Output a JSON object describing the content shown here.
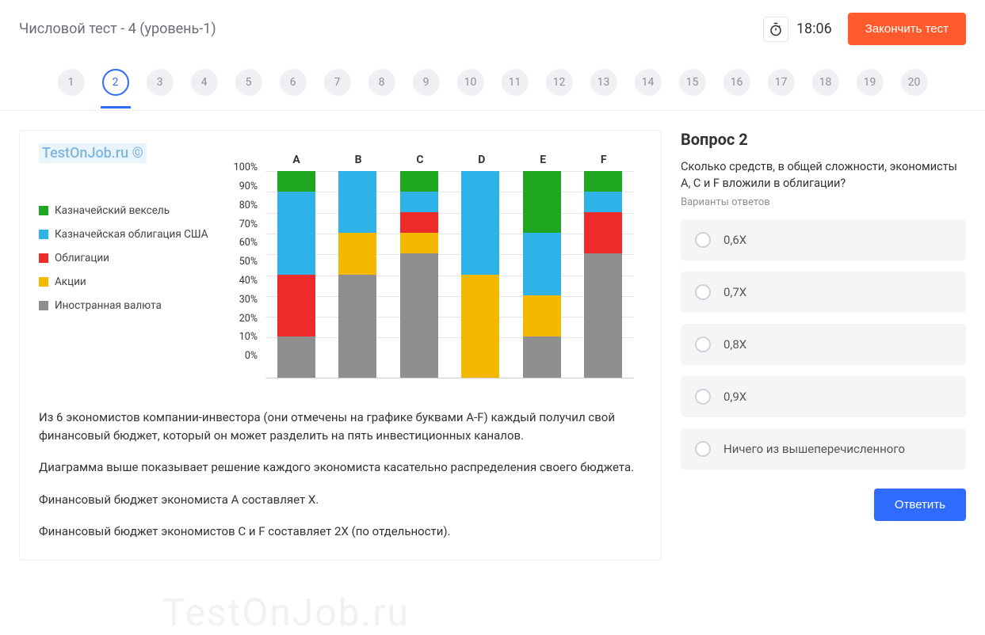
{
  "header": {
    "title": "Числовой тест - 4 (уровень-1)",
    "timer": "18:06",
    "finish_label": "Закончить тест"
  },
  "qnav": {
    "items": [
      "1",
      "2",
      "3",
      "4",
      "5",
      "6",
      "7",
      "8",
      "9",
      "10",
      "11",
      "12",
      "13",
      "14",
      "15",
      "16",
      "17",
      "18",
      "19",
      "20"
    ],
    "active_index": 1
  },
  "watermark": "TestOnJob.ru ©",
  "bg_watermark": "TestOnJob.ru",
  "legend": [
    {
      "label": "Казначейский вексель",
      "color": "#1fa81f"
    },
    {
      "label": "Казначейская облигация США",
      "color": "#2fb2e8"
    },
    {
      "label": "Облигации",
      "color": "#ef2a2a"
    },
    {
      "label": "Акции",
      "color": "#f5b800"
    },
    {
      "label": "Иностранная валюта",
      "color": "#8f8f8f"
    }
  ],
  "paragraphs": [
    "Из 6 экономистов компании-инвестора (они отмечены на графике буквами A-F) каждый получил свой финансовый бюджет, который он может разделить на пять инвестиционных каналов.",
    "Диаграмма выше показывает решение каждого экономиста касательно распределения своего бюджета.",
    "Финансовый бюджет экономиста A составляет X.",
    "Финансовый бюджет экономистов С и F составляет 2X  (по отдельности)."
  ],
  "question": {
    "heading": "Вопрос 2",
    "text": "Сколько средств, в общей сложности, экономисты A, C и F вложили в облигации?",
    "sub": "Варианты ответов",
    "options": [
      "0,6X",
      "0,7X",
      "0,8X",
      "0,9X",
      "Ничего из вышеперечисленного"
    ],
    "answer_btn": "Ответить"
  },
  "chart_data": {
    "type": "bar",
    "stacked": true,
    "categories": [
      "A",
      "B",
      "C",
      "D",
      "E",
      "F"
    ],
    "ylabel": "%",
    "ylim": [
      0,
      100
    ],
    "ticks": [
      "0%",
      "10%",
      "20%",
      "30%",
      "40%",
      "50%",
      "60%",
      "70%",
      "80%",
      "90%",
      "100%"
    ],
    "series": [
      {
        "name": "Иностранная валюта",
        "color": "#8f8f8f",
        "values": [
          20,
          50,
          60,
          0,
          20,
          60
        ]
      },
      {
        "name": "Акции",
        "color": "#f5b800",
        "values": [
          0,
          20,
          10,
          50,
          20,
          0
        ]
      },
      {
        "name": "Облигации",
        "color": "#ef2a2a",
        "values": [
          30,
          0,
          10,
          0,
          0,
          20
        ]
      },
      {
        "name": "Казначейская облигация США",
        "color": "#2fb2e8",
        "values": [
          40,
          30,
          10,
          50,
          30,
          10
        ]
      },
      {
        "name": "Казначейский вексель",
        "color": "#1fa81f",
        "values": [
          10,
          0,
          10,
          0,
          30,
          10
        ]
      }
    ]
  }
}
